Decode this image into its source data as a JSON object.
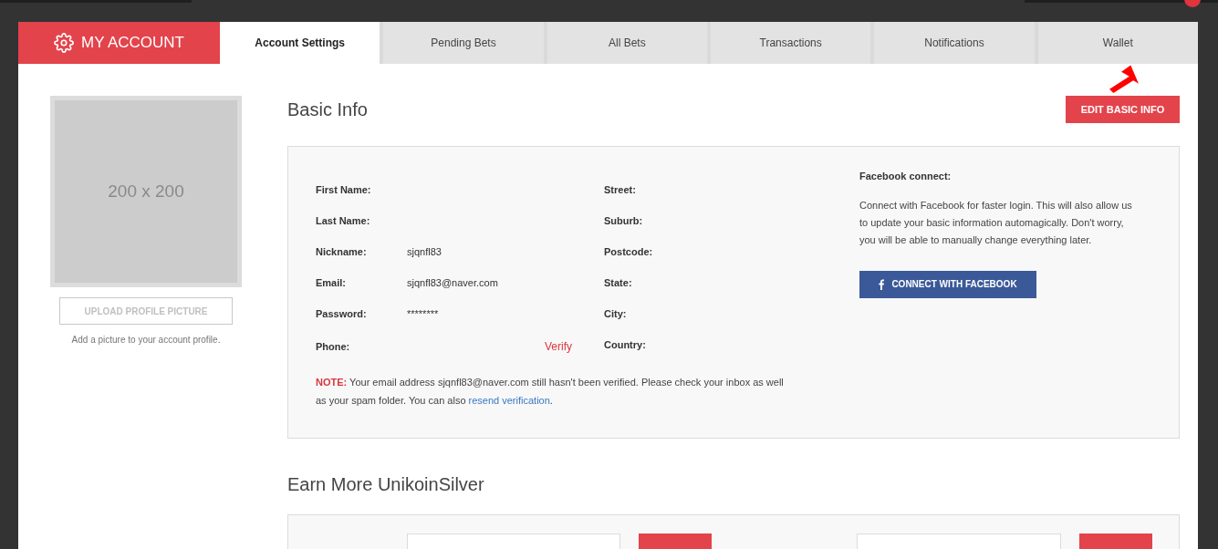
{
  "header": {
    "title": "MY ACCOUNT"
  },
  "tabs": [
    {
      "label": "Account Settings",
      "selected": true
    },
    {
      "label": "Pending Bets",
      "selected": false
    },
    {
      "label": "All Bets",
      "selected": false
    },
    {
      "label": "Transactions",
      "selected": false
    },
    {
      "label": "Notifications",
      "selected": false
    },
    {
      "label": "Wallet",
      "selected": false
    }
  ],
  "profile": {
    "placeholder_text": "200 x 200",
    "upload_button": "UPLOAD PROFILE PICTURE",
    "hint": "Add a picture to your account profile."
  },
  "basic_info": {
    "title": "Basic Info",
    "edit_button": "EDIT BASIC INFO",
    "left_fields": [
      {
        "label": "First Name:"
      },
      {
        "label": "Last Name:"
      },
      {
        "label": "Nickname:",
        "value": "sjqnfl83"
      },
      {
        "label": "Email:",
        "value": "sjqnfl83@naver.com"
      },
      {
        "label": "Password:",
        "value": "********"
      },
      {
        "label": "Phone:",
        "action": "Verify"
      }
    ],
    "right_fields": [
      {
        "label": "Street:"
      },
      {
        "label": "Suburb:"
      },
      {
        "label": "Postcode:"
      },
      {
        "label": "State:"
      },
      {
        "label": "City:"
      },
      {
        "label": "Country:"
      }
    ],
    "note": {
      "prefix": "NOTE:",
      "text": " Your email address sjqnfl83@naver.com still hasn't been verified. Please check your inbox as well as your spam folder. You can also ",
      "link": "resend verification",
      "suffix": "."
    },
    "facebook": {
      "title": "Facebook connect:",
      "text": "Connect with Facebook for faster login. This will also allow us to update your basic information automagically. Don't worry, you will be able to manually change everything later.",
      "button": "CONNECT WITH FACEBOOK"
    }
  },
  "earn": {
    "title": "Earn More UnikoinSilver"
  }
}
